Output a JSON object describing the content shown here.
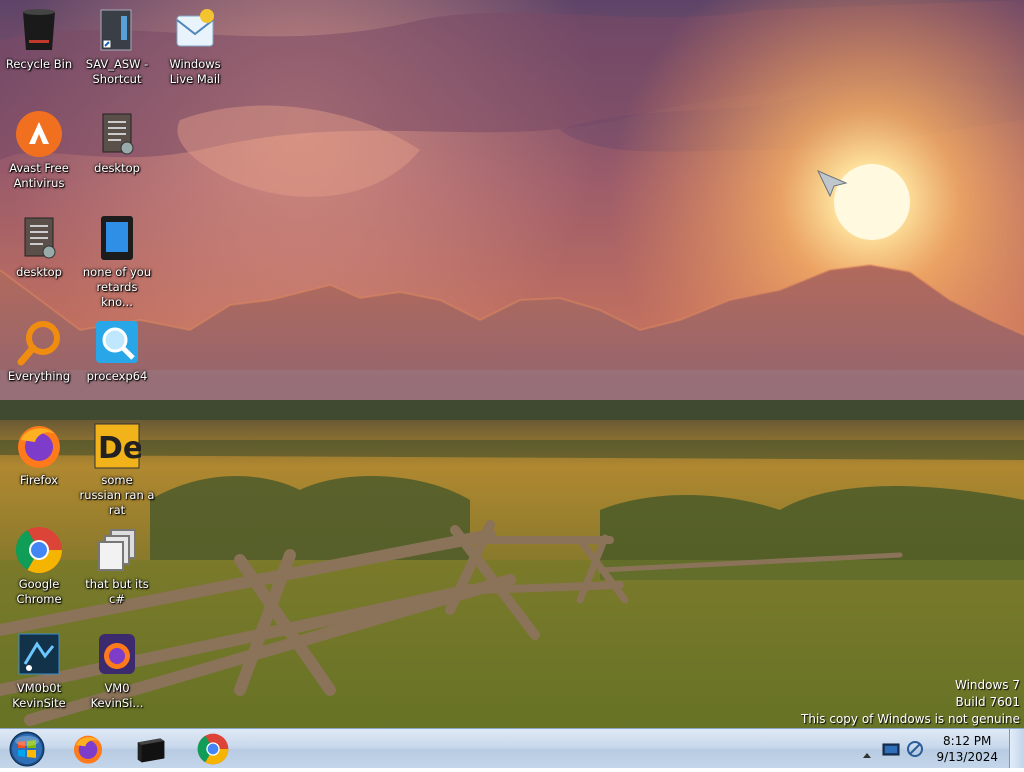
{
  "desktop_icons": [
    {
      "label": "Recycle Bin",
      "icon": "recycle-bin-icon"
    },
    {
      "label": "SAV_ASW - Shortcut",
      "icon": "shortcut-file-icon"
    },
    {
      "label": "Windows Live Mail",
      "icon": "windows-live-mail-icon"
    },
    {
      "label": "Avast Free Antivirus",
      "icon": "avast-icon"
    },
    {
      "label": "desktop",
      "icon": "text-file-icon"
    },
    {
      "label": "desktop",
      "icon": "text-file-icon"
    },
    {
      "label": "none of you retards kno...",
      "icon": "tablet-icon"
    },
    {
      "label": "Everything",
      "icon": "everything-search-icon"
    },
    {
      "label": "procexp64",
      "icon": "process-explorer-icon"
    },
    {
      "label": "Firefox",
      "icon": "firefox-icon"
    },
    {
      "label": "some russian ran a rat",
      "icon": "de-icon"
    },
    {
      "label": "Google Chrome",
      "icon": "chrome-icon"
    },
    {
      "label": "that but its c#",
      "icon": "copy-pages-icon"
    },
    {
      "label": "VM0b0t KevinSite",
      "icon": "vm-site-icon"
    },
    {
      "label": "VM0 KevinSi...",
      "icon": "firefox-profile-icon"
    }
  ],
  "watermark": {
    "line1": "Windows 7",
    "line2": "Build 7601",
    "line3": "This copy of Windows is not genuine"
  },
  "taskbar": {
    "start": "windows-start-orb",
    "pinned": [
      "firefox-icon",
      "terminal-icon",
      "chrome-icon"
    ],
    "tray_icons": [
      "show-hidden-icons-chevron",
      "network-monitor-icon",
      "network-icon"
    ],
    "time": "8:12 PM",
    "date": "9/13/2024"
  },
  "colors": {
    "taskbar": "#c9d9ec",
    "sky_top": "#6b4a6e",
    "sun": "#fff6c8",
    "field": "#8a7a2c"
  }
}
